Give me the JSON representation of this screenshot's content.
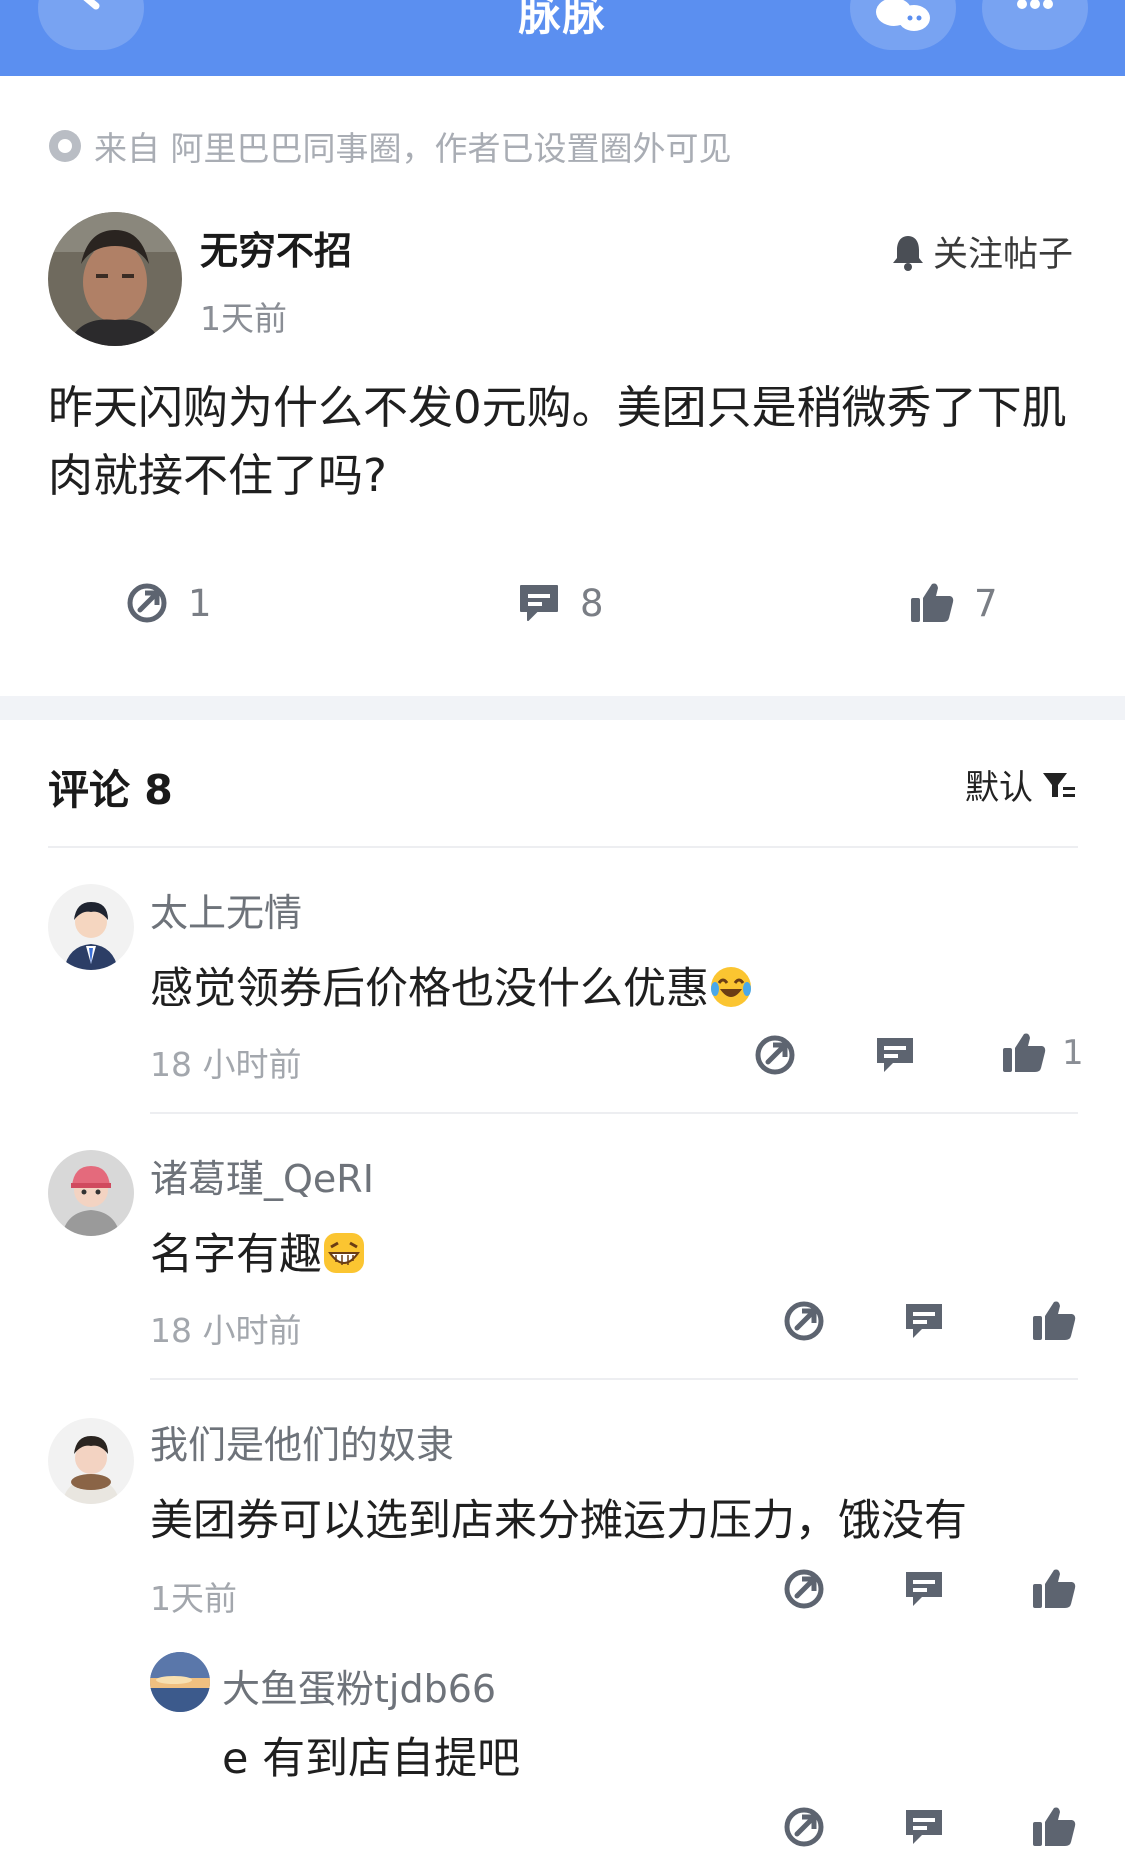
{
  "header": {
    "title": "脉脉"
  },
  "post": {
    "source": "来自 阿里巴巴同事圈，作者已设置圈外可见",
    "author": "无穷不招",
    "time": "1天前",
    "follow_label": "关注帖子",
    "text": "昨天闪购为什么不发0元购。美团只是稍微秀了下肌肉就接不住了吗?",
    "stats": {
      "shares": "1",
      "comments": "8",
      "likes": "7"
    }
  },
  "comments_section": {
    "title": "评论 8",
    "sort_label": "默认"
  },
  "comments": [
    {
      "name": "太上无情",
      "text": "感觉领券后价格也没什么优惠",
      "time": "18 小时前",
      "likes": "1"
    },
    {
      "name": "诸葛瑾_QeRI",
      "text": "名字有趣",
      "time": "18 小时前",
      "likes": ""
    },
    {
      "name": "我们是他们的奴隶",
      "text": "美团券可以选到店来分摊运力压力，饿没有",
      "time": "1天前",
      "likes": ""
    }
  ],
  "reply": {
    "name": "大鱼蛋粉tjdb66",
    "text": "e 有到店自提吧"
  },
  "colors": {
    "header": "#5b8ff0",
    "icon": "#5d6470"
  }
}
